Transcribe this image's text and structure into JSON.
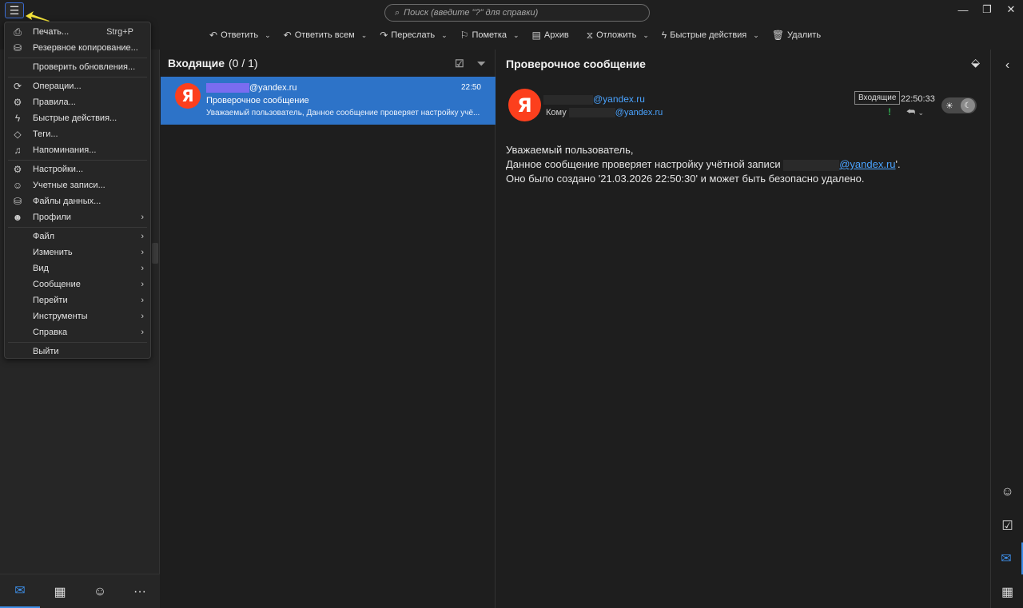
{
  "titlebar": {
    "search_placeholder": "Поиск (введите \"?\" для справки)"
  },
  "toolbar": {
    "reply": "Ответить",
    "reply_all": "Ответить всем",
    "forward": "Переслать",
    "flag": "Пометка",
    "archive": "Архив",
    "snooze": "Отложить",
    "quick_actions": "Быстрые действия",
    "delete": "Удалить"
  },
  "menu": {
    "print": "Печать...",
    "print_shortcut": "Strg+P",
    "backup": "Резервное копирование...",
    "check_updates": "Проверить обновления...",
    "operations": "Операции...",
    "rules": "Правила...",
    "quick_actions": "Быстрые действия...",
    "tags": "Теги...",
    "reminders": "Напоминания...",
    "settings": "Настройки...",
    "accounts": "Учетные записи...",
    "data_files": "Файлы данных...",
    "profiles": "Профили",
    "file": "Файл",
    "edit": "Изменить",
    "view": "Вид",
    "message": "Сообщение",
    "go": "Перейти",
    "tools": "Инструменты",
    "help": "Справка",
    "exit": "Выйти"
  },
  "list": {
    "folder_title": "Входящие",
    "count": "(0 / 1)",
    "messages": [
      {
        "avatar_letter": "Я",
        "from_domain": "@yandex.ru",
        "time": "22:50",
        "subject": "Проверочное сообщение",
        "preview": "Уважаемый пользователь, Данное сообщение проверяет настройку учё..."
      }
    ]
  },
  "reader": {
    "subject": "Проверочное сообщение",
    "avatar_letter": "Я",
    "from_domain": "@yandex.ru",
    "to_label": "Кому",
    "to_domain": "@yandex.ru",
    "folder_badge": "Входящие",
    "time": "22:50:33",
    "flag_mark": "!",
    "body_line1": "Уважаемый пользователь,",
    "body_line2_prefix": "Данное сообщение проверяет настройку учётной записи",
    "body_line2_link": "@yandex.ru",
    "body_line2_suffix": "'.",
    "body_line3": "Оно было создано '21.03.2026 22:50:30' и может быть безопасно удалено."
  },
  "colors": {
    "accent": "#2d73c8",
    "link": "#4aa3ff",
    "yandex_red": "#fc3f1d",
    "background": "#1e1e1e"
  },
  "icons": {
    "menu": "hamburger-icon",
    "search": "search-icon",
    "mail": "mail-icon",
    "calendar": "calendar-icon",
    "contacts": "person-icon",
    "more": "more-icon"
  }
}
